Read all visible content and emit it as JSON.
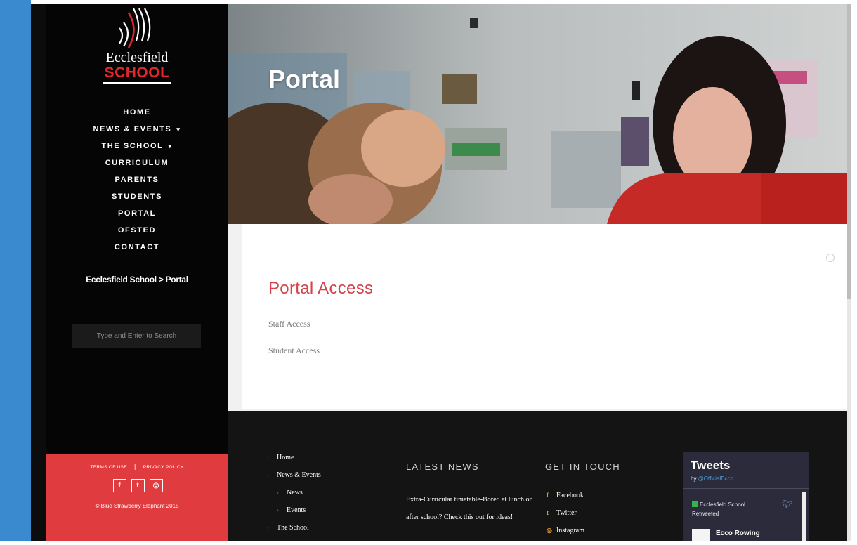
{
  "site": {
    "logo": {
      "line1": "Ecclesfield",
      "line2": "SCHOOL"
    },
    "nav": [
      {
        "label": "HOME"
      },
      {
        "label": "NEWS & EVENTS",
        "has_dropdown": true
      },
      {
        "label": "THE SCHOOL",
        "has_dropdown": true
      },
      {
        "label": "CURRICULUM"
      },
      {
        "label": "PARENTS"
      },
      {
        "label": "STUDENTS"
      },
      {
        "label": "PORTAL"
      },
      {
        "label": "OFSTED"
      },
      {
        "label": "CONTACT"
      }
    ],
    "breadcrumb": {
      "text": "Ecclesfield School > Portal"
    },
    "search": {
      "placeholder": "Type and Enter to Search"
    },
    "sidebar_footer": {
      "terms": "TERMS OF USE",
      "divider": "|",
      "privacy": "PRIVACY POLICY",
      "social_icons": [
        "facebook-icon",
        "twitter-icon",
        "instagram-icon"
      ],
      "social_glyphs": [
        "f",
        "t",
        "◎"
      ],
      "credit": "© Blue Strawberry Elephant 2015"
    }
  },
  "hero": {
    "title": "Portal"
  },
  "content": {
    "heading": "Portal Access",
    "links": [
      "Staff Access",
      "Student Access"
    ]
  },
  "footer": {
    "links": [
      {
        "label": "Home",
        "level": 0
      },
      {
        "label": "News & Events",
        "level": 0
      },
      {
        "label": "News",
        "level": 1
      },
      {
        "label": "Events",
        "level": 1
      },
      {
        "label": "The School",
        "level": 0
      }
    ],
    "latest_news": {
      "heading": "LATEST NEWS",
      "text": "Extra-Curricular timetable-Bored at lunch or after school? Check this out for ideas!"
    },
    "get_in_touch": {
      "heading": "GET IN TOUCH",
      "items": [
        {
          "label": "Facebook",
          "icon": "f"
        },
        {
          "label": "Twitter",
          "icon": "t"
        },
        {
          "label": "Instagram",
          "icon": "◎"
        }
      ]
    },
    "tweets": {
      "title": "Tweets",
      "by_prefix": "by",
      "handle": "@OfficialEcco",
      "retweet_line1": "Ecclesfield School",
      "retweet_line2": "Retweeted",
      "author": "Ecco Rowing"
    }
  },
  "colors": {
    "accent_red": "#d6434a",
    "sidebar_footer_red": "#e03b3f",
    "sidebar_bg": "#050505",
    "footer_bg": "#141414",
    "link_blue": "#4aa8e8"
  }
}
